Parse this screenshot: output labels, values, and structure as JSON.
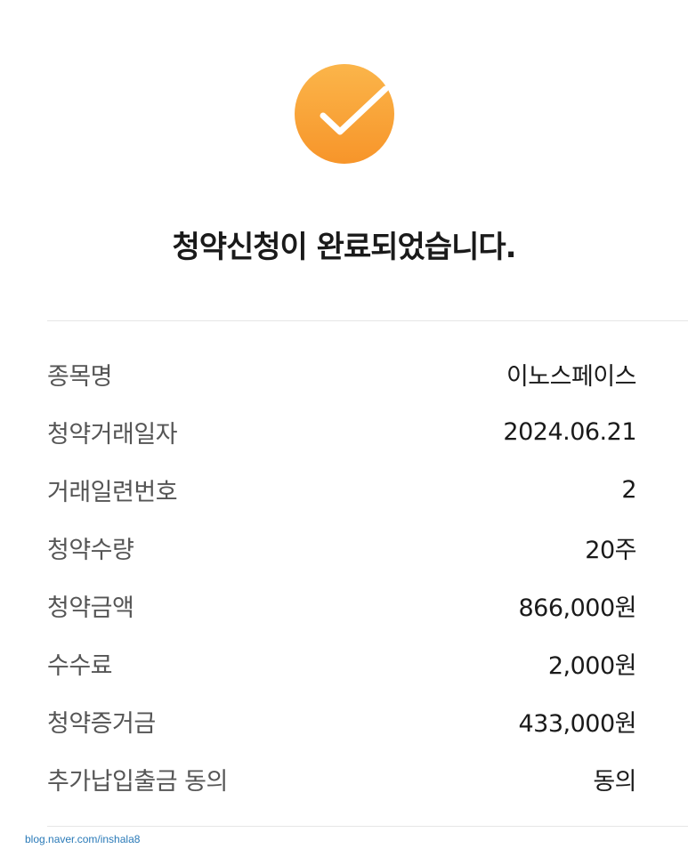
{
  "status": {
    "icon": "check-circle-icon",
    "accent_color": "#f9a23a",
    "title": "청약신청이 완료되었습니다."
  },
  "details": [
    {
      "label": "종목명",
      "value": "이노스페이스"
    },
    {
      "label": "청약거래일자",
      "value": "2024.06.21"
    },
    {
      "label": "거래일련번호",
      "value": "2"
    },
    {
      "label": "청약수량",
      "value": "20주"
    },
    {
      "label": "청약금액",
      "value": "866,000원"
    },
    {
      "label": "수수료",
      "value": "2,000원"
    },
    {
      "label": "청약증거금",
      "value": "433,000원"
    },
    {
      "label": "추가납입출금 동의",
      "value": "동의"
    }
  ],
  "watermark": "blog.naver.com/inshala8"
}
